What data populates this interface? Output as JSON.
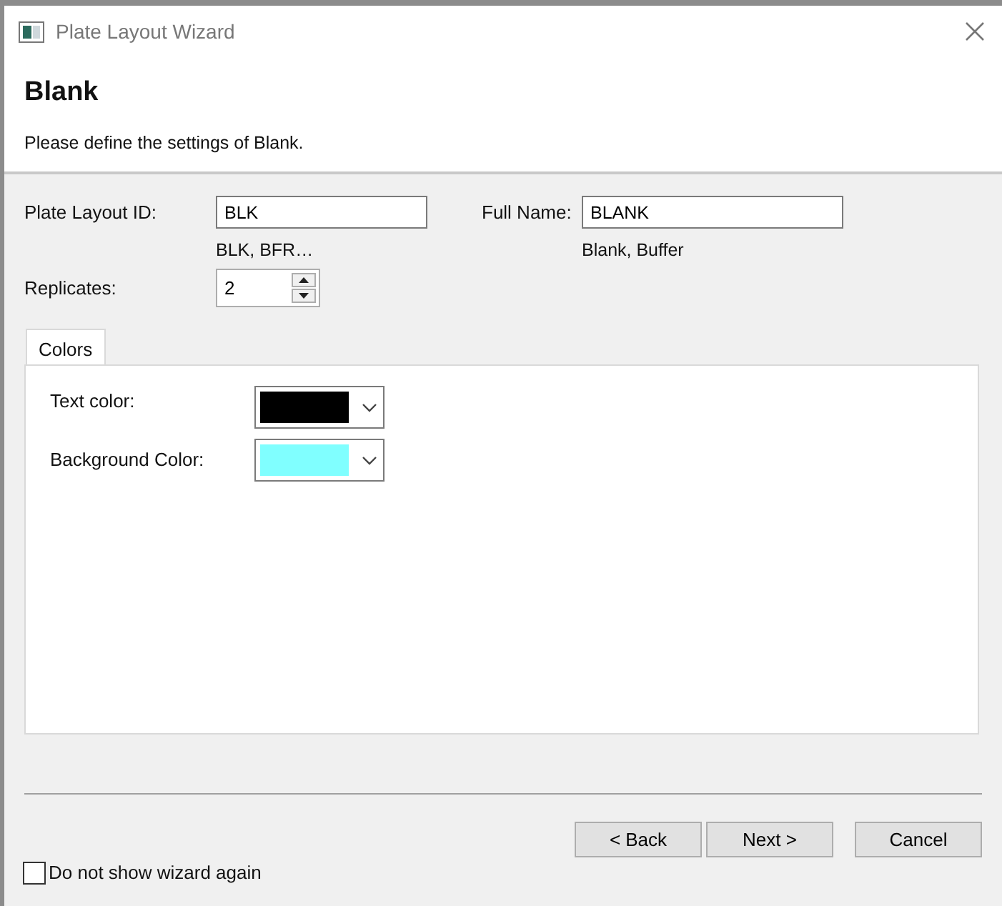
{
  "window": {
    "title": "Plate Layout Wizard"
  },
  "header": {
    "title": "Blank",
    "subtitle": "Please define the settings of Blank."
  },
  "fields": [
    {
      "label": "Plate Layout ID:",
      "value": "BLK",
      "hint": "BLK, BFR…"
    },
    {
      "label": "Full Name:",
      "value": "BLANK",
      "hint": "Blank, Buffer"
    }
  ],
  "replicates": {
    "label": "Replicates:",
    "value": "2"
  },
  "tabs": [
    {
      "label": "Colors",
      "selected": true
    }
  ],
  "color_pickers": [
    {
      "label": "Text color:",
      "color": "#000000"
    },
    {
      "label": "Background Color:",
      "color": "#80ffff"
    }
  ],
  "buttons": [
    "< Back",
    "Next >",
    "Cancel"
  ],
  "dont_show_again": {
    "label": "Do not show wizard again",
    "checked": false
  }
}
